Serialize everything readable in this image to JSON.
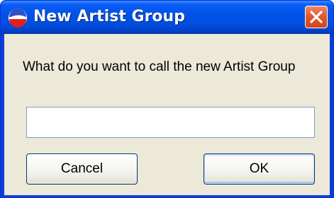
{
  "window": {
    "title": "New Artist Group",
    "icon": "app-icon",
    "close_icon": "close-icon"
  },
  "dialog": {
    "prompt": "What do you want to call the new Artist Group",
    "input_value": "",
    "cancel_label": "Cancel",
    "ok_label": "OK"
  },
  "colors": {
    "titlebar": "#0052e8",
    "client_background": "#ece9d8",
    "close_button": "#e35a30"
  }
}
